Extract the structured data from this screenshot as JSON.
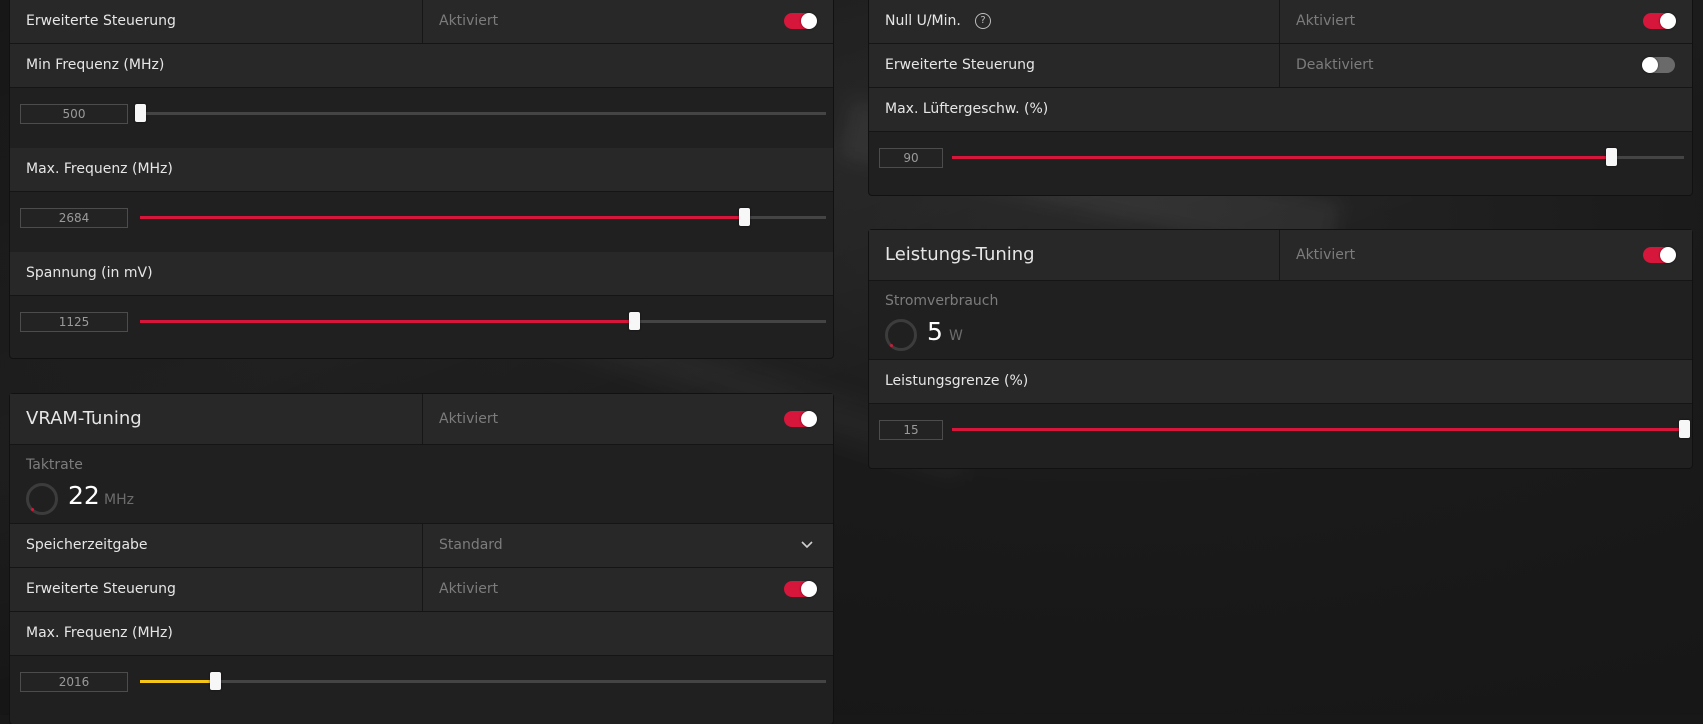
{
  "gpu_panel": {
    "advanced": {
      "label": "Erweiterte Steuerung",
      "status": "Aktiviert",
      "enabled": true
    },
    "min_freq": {
      "label": "Min Frequenz (MHz)",
      "value": "500",
      "fraction": 0.0
    },
    "max_freq": {
      "label": "Max. Frequenz (MHz)",
      "value": "2684",
      "fraction": 0.88
    },
    "voltage": {
      "label": "Spannung (in mV)",
      "value": "1125",
      "fraction": 0.72
    }
  },
  "vram_panel": {
    "title": "VRAM-Tuning",
    "status": "Aktiviert",
    "enabled": true,
    "clock_label": "Taktrate",
    "clock_value": "22",
    "clock_unit": "MHz",
    "timing": {
      "label": "Speicherzeitgabe",
      "value": "Standard"
    },
    "advanced": {
      "label": "Erweiterte Steuerung",
      "status": "Aktiviert",
      "enabled": true
    },
    "max_freq": {
      "label": "Max. Frequenz (MHz)",
      "value": "2016",
      "fraction": 0.11
    }
  },
  "fan_panel": {
    "zero_rpm": {
      "label": "Null U/Min.",
      "status": "Aktiviert",
      "enabled": true
    },
    "advanced": {
      "label": "Erweiterte Steuerung",
      "status": "Deaktiviert",
      "enabled": false
    },
    "max_fan": {
      "label": "Max. Lüftergeschw. (%)",
      "value": "90",
      "fraction": 0.9
    }
  },
  "power_panel": {
    "title": "Leistungs-Tuning",
    "status": "Aktiviert",
    "enabled": true,
    "power_label": "Stromverbrauch",
    "power_value": "5",
    "power_unit": "W",
    "limit": {
      "label": "Leistungsgrenze (%)",
      "value": "15",
      "fraction": 1.0
    }
  },
  "colors": {
    "accent": "#d6163a",
    "vram_slider": "#f5c518",
    "panel": "#202020",
    "row": "#282828"
  },
  "icons": {
    "help": "question-circle-icon",
    "dropdown": "chevron-down-icon",
    "gauge": "ring-gauge-icon"
  }
}
